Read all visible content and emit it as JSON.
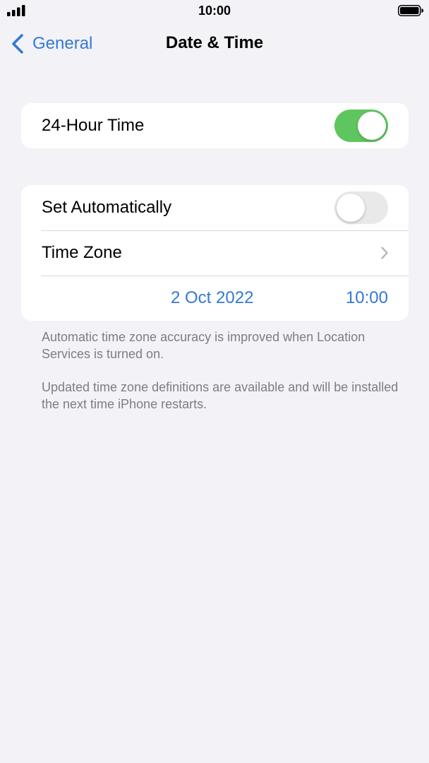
{
  "status_bar": {
    "time": "10:00",
    "signal_icon": "signal-bars-icon",
    "battery_icon": "battery-full-icon"
  },
  "nav": {
    "back_label": "General",
    "back_icon": "chevron-left-icon",
    "title": "Date & Time"
  },
  "settings": {
    "hour24": {
      "label": "24-Hour Time",
      "on": true
    },
    "set_automatically": {
      "label": "Set Automatically",
      "on": false
    },
    "time_zone": {
      "label": "Time Zone",
      "icon": "chevron-right-icon"
    },
    "date": "2 Oct 2022",
    "time": "10:00"
  },
  "footnotes": [
    "Automatic time zone accuracy is improved when Location Services is turned on.",
    "Updated time zone definitions are available and will be installed the next time iPhone restarts."
  ],
  "colors": {
    "accent": "#3478d6",
    "toggle_on": "#5fc65f",
    "toggle_off": "#e9e9ea",
    "background": "#f2f2f7",
    "footnote": "#7d7d82"
  }
}
